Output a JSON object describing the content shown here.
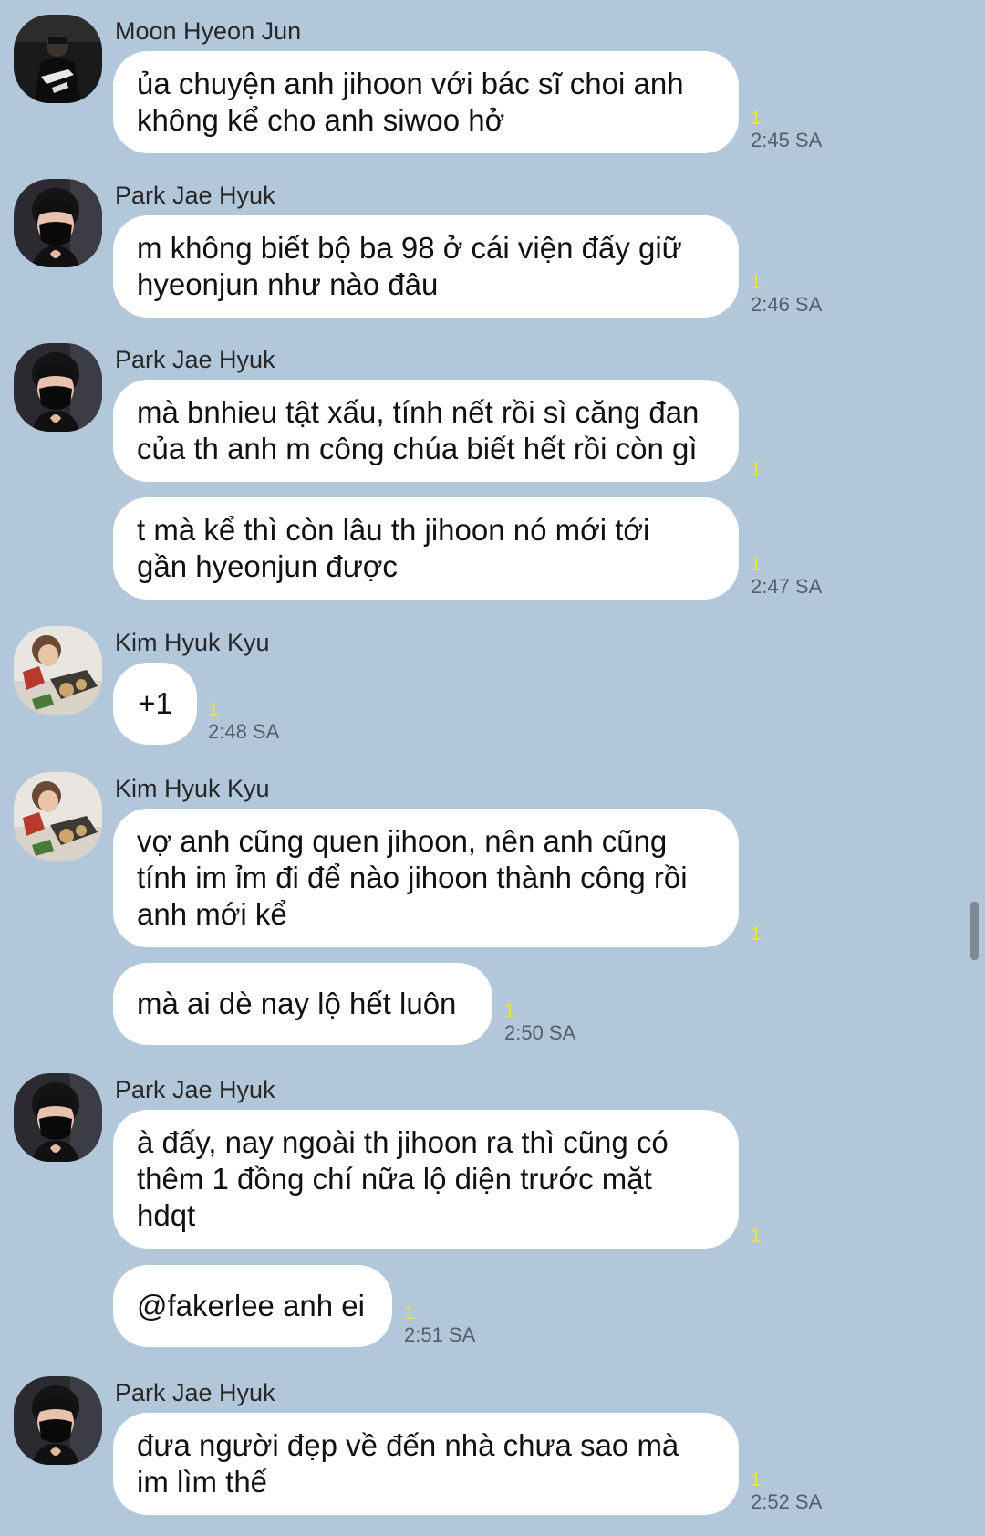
{
  "senders": {
    "moon": "Moon Hyeon Jun",
    "park": "Park Jae Hyuk",
    "kim": "Kim Hyuk Kyu"
  },
  "unread": "1",
  "messages": [
    {
      "text": "ủa chuyện anh jihoon với bác sĩ choi anh\nkhông kể cho anh siwoo hở",
      "time": "2:45 SA"
    },
    {
      "text": "m không biết bộ ba 98 ở cái viện đấy giữ\nhyeonjun như nào đâu",
      "time": "2:46 SA"
    },
    {
      "text": "mà bnhieu tật xấu, tính nết rồi sì căng đan\ncủa th anh m công chúa biết hết rồi còn gì",
      "time": ""
    },
    {
      "text": "t mà kể thì còn lâu th jihoon nó mới tới\ngần hyeonjun được",
      "time": "2:47 SA"
    },
    {
      "text": "+1",
      "time": "2:48 SA"
    },
    {
      "text": "vợ anh cũng quen jihoon, nên anh cũng\ntính im ỉm đi để nào jihoon thành công rồi\nanh mới kể",
      "time": ""
    },
    {
      "text": "mà ai dè nay lộ hết luôn",
      "time": "2:50 SA"
    },
    {
      "text": "à đấy, nay ngoài th jihoon ra thì cũng có\nthêm 1 đồng chí nữa lộ diện trước mặt\nhdqt",
      "time": ""
    },
    {
      "text": "@fakerlee anh ei",
      "time": "2:51 SA"
    },
    {
      "text": "đưa người đẹp về đến nhà chưa sao mà\nim lìm thế",
      "time": "2:52 SA"
    }
  ]
}
